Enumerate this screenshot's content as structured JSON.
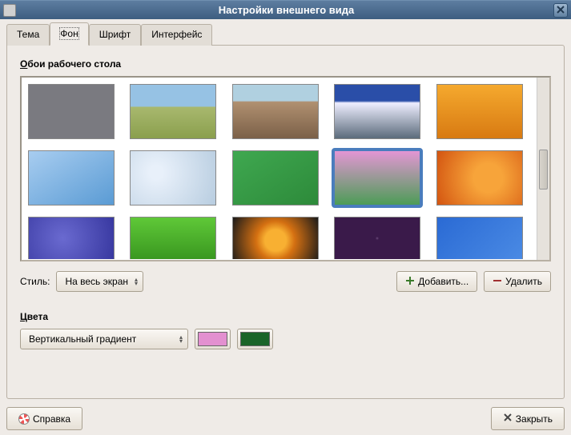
{
  "window": {
    "title": "Настройки внешнего вида"
  },
  "tabs": [
    {
      "label": "Тема"
    },
    {
      "label": "Фон"
    },
    {
      "label": "Шрифт"
    },
    {
      "label": "Интерфейс"
    }
  ],
  "active_tab": 1,
  "wallpaper_section": "Обои рабочего стола",
  "wallpapers": [
    {
      "id": "w1",
      "bg": "#7a7a80"
    },
    {
      "id": "w2",
      "bg": "linear-gradient(to bottom,#96c2e4 40%,#a8b86e 42%,#8a9f4d)"
    },
    {
      "id": "w3",
      "bg": "linear-gradient(to bottom,#b0d0e0 30%,#b09070 32%,#7b6048)"
    },
    {
      "id": "w4",
      "bg": "linear-gradient(to bottom,#2a4ea8 30%,#eef 34%,#5b6b7b)"
    },
    {
      "id": "w5",
      "bg": "linear-gradient(to bottom,#f5a92e,#d87a12)"
    },
    {
      "id": "w6",
      "bg": "linear-gradient(to bottom right,#a8cdf0,#5a9bd4)"
    },
    {
      "id": "w7",
      "bg": "radial-gradient(circle at 30% 40%,#e8f0fa 10%,#b8cde0)"
    },
    {
      "id": "w8",
      "bg": "linear-gradient(to bottom right,#3fa850,#2d8a3a)"
    },
    {
      "id": "w9",
      "bg": "linear-gradient(to bottom,#e396d4,#4c9c56)",
      "selected": true
    },
    {
      "id": "w10",
      "bg": "radial-gradient(circle at 60% 50%,#f7a43a 25%,#d35410)"
    },
    {
      "id": "w11",
      "bg": "radial-gradient(circle at 40% 50%,#6a6ad0,#3838a0)"
    },
    {
      "id": "w12",
      "bg": "linear-gradient(to bottom,#5fc838,#3a9820)"
    },
    {
      "id": "w13",
      "bg": "radial-gradient(circle at 50% 55%,#f8b032 22%,#d47012 40%,#1a1a1a)"
    },
    {
      "id": "w14",
      "bg": "radial-gradient(circle,#5a3a6a 1px,#3a1a4a 2px)"
    },
    {
      "id": "w15",
      "bg": "linear-gradient(135deg,#2a6ad4,#4a8ae4)"
    }
  ],
  "style_label": "Стиль:",
  "style_value": "На весь экран",
  "add_button": "Добавить...",
  "remove_button": "Удалить",
  "colors_label": "Цвета",
  "gradient_value": "Вертикальный градиент",
  "color1": "#e390d0",
  "color2": "#1a6428",
  "help_button": "Справка",
  "close_button": "Закрыть"
}
